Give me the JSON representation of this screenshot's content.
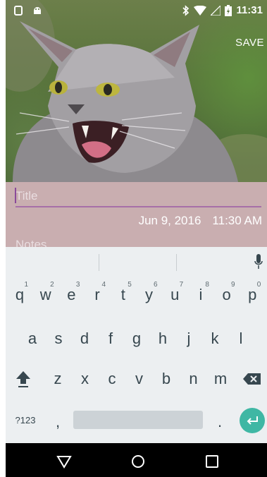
{
  "status_bar": {
    "time": "11:31",
    "icons": [
      "android-debug-icon",
      "android-icon",
      "bluetooth-icon",
      "wifi-icon",
      "signal-icon",
      "battery-charging-icon"
    ]
  },
  "toolbar": {
    "save_label": "SAVE"
  },
  "form": {
    "title_placeholder": "Title",
    "date": "Jun 9, 2016",
    "time": "11:30 AM",
    "notes_placeholder": "Notes"
  },
  "keyboard": {
    "row1": [
      {
        "key": "q",
        "hint": "1"
      },
      {
        "key": "w",
        "hint": "2"
      },
      {
        "key": "e",
        "hint": "3"
      },
      {
        "key": "r",
        "hint": "4"
      },
      {
        "key": "t",
        "hint": "5"
      },
      {
        "key": "y",
        "hint": "6"
      },
      {
        "key": "u",
        "hint": "7"
      },
      {
        "key": "i",
        "hint": "8"
      },
      {
        "key": "o",
        "hint": "9"
      },
      {
        "key": "p",
        "hint": "0"
      }
    ],
    "row2": [
      "a",
      "s",
      "d",
      "f",
      "g",
      "h",
      "j",
      "k",
      "l"
    ],
    "row3": [
      "z",
      "x",
      "c",
      "v",
      "b",
      "n",
      "m"
    ],
    "symbols_label": "?123",
    "comma": ",",
    "period": "."
  },
  "icons": {
    "shift": "shift-icon",
    "backspace": "backspace-icon",
    "enter": "enter-icon",
    "mic": "mic-icon",
    "back": "back-icon",
    "home": "home-icon",
    "recents": "recents-icon"
  },
  "colors": {
    "form_background": "#c9aeb0",
    "title_underline": "#a66fa8",
    "enter_button": "#3fb7a4",
    "keyboard_background": "#eceff1"
  }
}
